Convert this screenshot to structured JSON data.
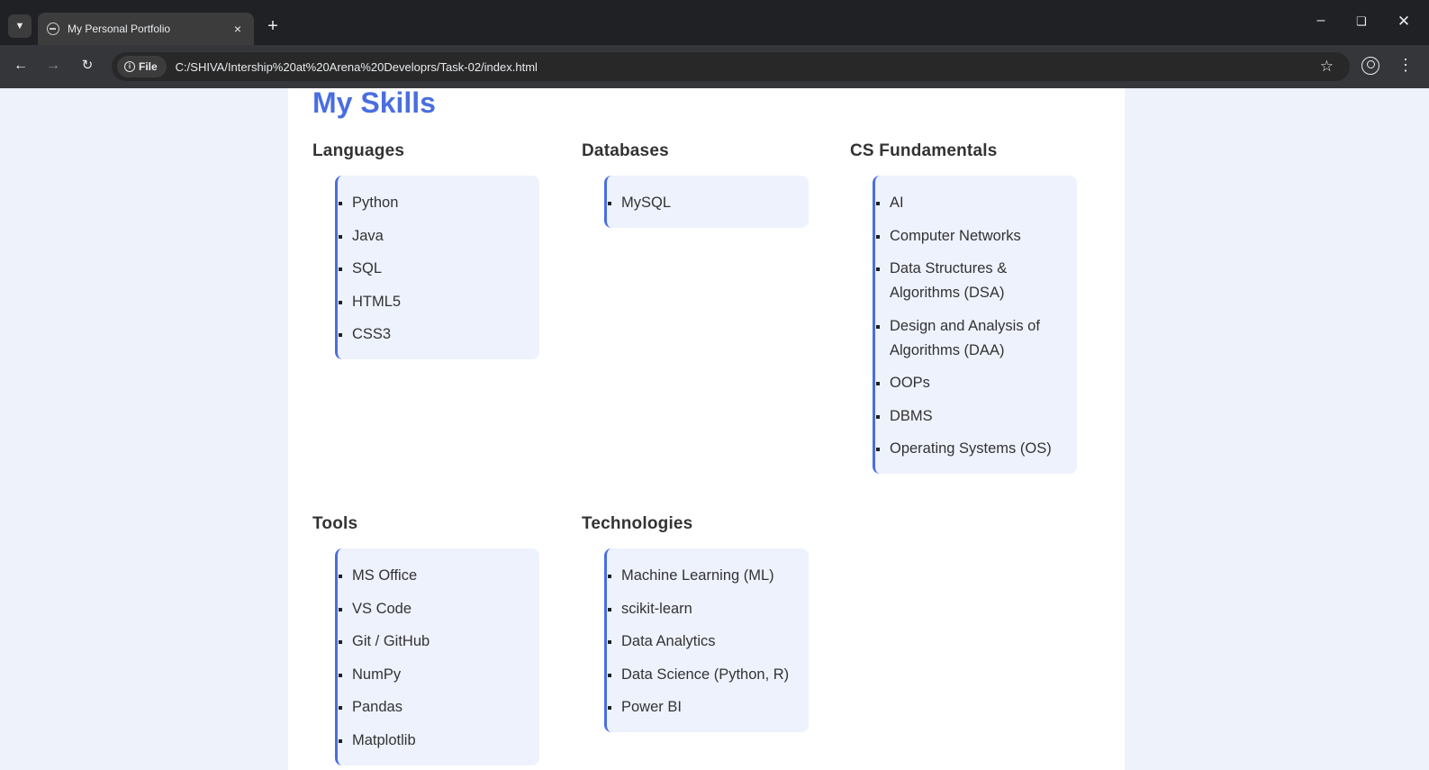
{
  "browser": {
    "tab_title": "My Personal Portfolio",
    "tab_close": "×",
    "new_tab": "+",
    "site_chip": "File",
    "url": "C:/SHIVA/Intership%20at%20Arena%20Developrs/Task-02/index.html",
    "icons": [
      "tab-list-icon",
      "globe-icon",
      "back-icon",
      "forward-icon",
      "reload-icon",
      "info-icon",
      "star-icon",
      "profile-icon",
      "more-icon",
      "minimize-icon",
      "restore-icon",
      "close-icon"
    ]
  },
  "page": {
    "section_title": "My Skills",
    "accent_color": "#4a6ee0",
    "groups": {
      "languages": {
        "title": "Languages",
        "items": [
          "Python",
          "Java",
          "SQL",
          "HTML5",
          "CSS3"
        ]
      },
      "databases": {
        "title": "Databases",
        "items": [
          "MySQL"
        ]
      },
      "cs_fundamentals": {
        "title": "CS Fundamentals",
        "items": [
          "AI",
          "Computer Networks",
          "Data Structures & Algorithms (DSA)",
          "Design and Analysis of Algorithms (DAA)",
          "OOPs",
          "DBMS",
          "Operating Systems (OS)"
        ]
      },
      "tools": {
        "title": "Tools",
        "items": [
          "MS Office",
          "VS Code",
          "Git / GitHub",
          "NumPy",
          "Pandas",
          "Matplotlib"
        ]
      },
      "technologies": {
        "title": "Technologies",
        "items": [
          "Machine Learning (ML)",
          "scikit-learn",
          "Data Analytics",
          "Data Science (Python, R)",
          "Power BI"
        ]
      }
    }
  }
}
